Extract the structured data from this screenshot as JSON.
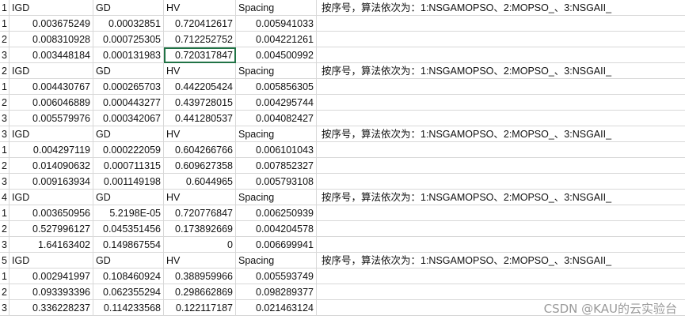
{
  "sheet": {
    "selected": {
      "block": 0,
      "row": 2,
      "col": 3
    },
    "blocks": [
      {
        "index": "1",
        "headers": [
          "IGD",
          "GD",
          "HV",
          "Spacing"
        ],
        "note": "按序号，算法依次为：1:NSGAMOPSO、2:MOPSO_、3:NSGAII_",
        "rows": [
          [
            "1",
            "0.003675249",
            "0.00032851",
            "0.720412617",
            "0.005941033"
          ],
          [
            "2",
            "0.008310928",
            "0.000725305",
            "0.712252752",
            "0.004221261"
          ],
          [
            "3",
            "0.003448184",
            "0.000131983",
            "0.720317847",
            "0.004500992"
          ]
        ]
      },
      {
        "index": "2",
        "headers": [
          "IGD",
          "GD",
          "HV",
          "Spacing"
        ],
        "note": "按序号，算法依次为：1:NSGAMOPSO、2:MOPSO_、3:NSGAII_",
        "rows": [
          [
            "1",
            "0.004430767",
            "0.000265703",
            "0.442205424",
            "0.005856305"
          ],
          [
            "2",
            "0.006046889",
            "0.000443277",
            "0.439728015",
            "0.004295744"
          ],
          [
            "3",
            "0.005579976",
            "0.000342067",
            "0.441280537",
            "0.004082427"
          ]
        ]
      },
      {
        "index": "3",
        "headers": [
          "IGD",
          "GD",
          "HV",
          "Spacing"
        ],
        "note": "按序号，算法依次为：1:NSGAMOPSO、2:MOPSO_、3:NSGAII_",
        "rows": [
          [
            "1",
            "0.004297119",
            "0.000222059",
            "0.604266766",
            "0.006101043"
          ],
          [
            "2",
            "0.014090632",
            "0.000711315",
            "0.609627358",
            "0.007852327"
          ],
          [
            "3",
            "0.009163934",
            "0.001149198",
            "0.6044965",
            "0.005793108"
          ]
        ]
      },
      {
        "index": "4",
        "headers": [
          "IGD",
          "GD",
          "HV",
          "Spacing"
        ],
        "note": "按序号，算法依次为：1:NSGAMOPSO、2:MOPSO_、3:NSGAII_",
        "rows": [
          [
            "1",
            "0.003650956",
            "5.2198E-05",
            "0.720776847",
            "0.006250939"
          ],
          [
            "2",
            "0.527996127",
            "0.045351456",
            "0.173892669",
            "0.004204578"
          ],
          [
            "3",
            "1.64163402",
            "0.149867554",
            "0",
            "0.006699941"
          ]
        ]
      },
      {
        "index": "5",
        "headers": [
          "IGD",
          "GD",
          "HV",
          "Spacing"
        ],
        "note": "按序号，算法依次为：1:NSGAMOPSO、2:MOPSO_、3:NSGAII_",
        "rows": [
          [
            "1",
            "0.002941997",
            "0.108460924",
            "0.388959966",
            "0.005593749"
          ],
          [
            "2",
            "0.093393396",
            "0.062355294",
            "0.298662869",
            "0.098289377"
          ],
          [
            "3",
            "0.336228237",
            "0.114233568",
            "0.122117187",
            "0.021463124"
          ]
        ]
      }
    ]
  },
  "watermark": "CSDN @KAU的云实验台"
}
